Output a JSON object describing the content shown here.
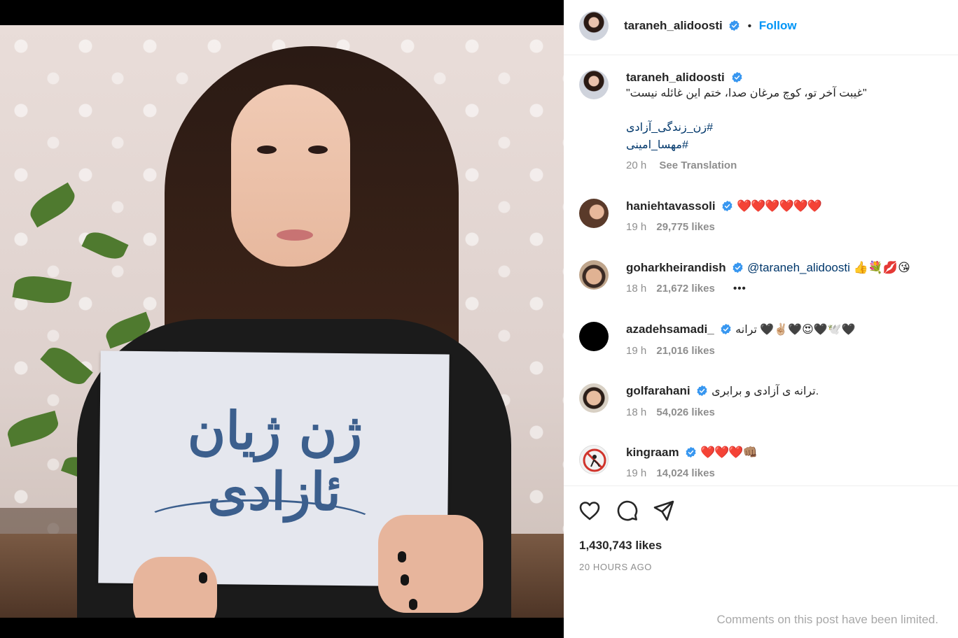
{
  "post": {
    "username": "taraneh_alidoosti",
    "follow_label": "Follow",
    "separator": "•"
  },
  "caption": {
    "username": "taraneh_alidoosti",
    "text": "\"غیبت آخر تو، کوچ مرغان صدا، ختم این غائله نیست\"",
    "hashtag_1": "#زن_زندگی_آزادی",
    "hashtag_2": "#مهسا_امینی",
    "time": "20 h",
    "see_translation": "See Translation"
  },
  "comments": [
    {
      "username": "haniehtavassoli",
      "text": "❤️❤️❤️❤️❤️❤️",
      "time": "19 h",
      "likes": "29,775 likes"
    },
    {
      "username": "goharkheirandish",
      "mention": "@taraneh_alidoosti",
      "text": " 👍💐💋😘",
      "time": "18 h",
      "likes": "21,672 likes",
      "more": "•••"
    },
    {
      "username": "azadehsamadi_",
      "text": "ترانه 🖤✌🏼🖤😍🖤🕊️🖤",
      "time": "19 h",
      "likes": "21,016 likes"
    },
    {
      "username": "golfarahani",
      "text": "ترانه ی آزادی و برابری.",
      "time": "18 h",
      "likes": "54,026 likes"
    },
    {
      "username": "kingraam",
      "text": "❤️❤️❤️👊🏽",
      "time": "19 h",
      "likes": "14,024 likes"
    }
  ],
  "photo": {
    "sign_text": "ژن ژیان ئازادی"
  },
  "footer": {
    "likes": "1,430,743 likes",
    "time_ago": "20 HOURS AGO",
    "limited_notice": "Comments on this post have been limited."
  },
  "colors": {
    "accent": "#0095f6",
    "verified": "#3897f0",
    "text": "#262626",
    "muted": "#8e8e8e"
  },
  "icons": {
    "like": "heart-icon",
    "comment": "comment-icon",
    "share": "share-icon",
    "verified": "verified-badge-icon"
  }
}
